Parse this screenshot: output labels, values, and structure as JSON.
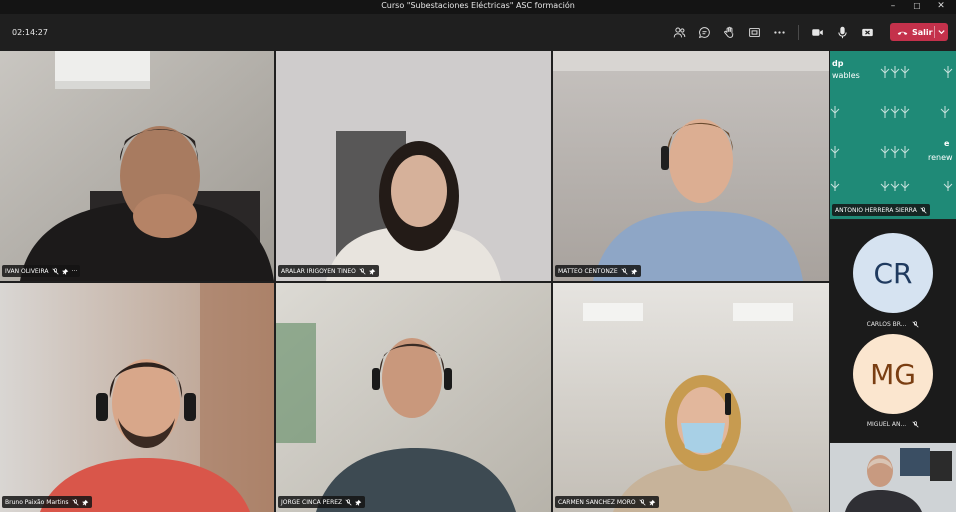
{
  "window": {
    "title": "Curso \"Subestaciones Eléctricas\" ASC formación",
    "minimize": "–",
    "maximize": "☐",
    "close": "✕"
  },
  "toolbar": {
    "timer": "02:14:27",
    "leave_label": "Salir"
  },
  "participants": [
    {
      "name": "IVAN OLIVEIRA",
      "more": "···"
    },
    {
      "name": "ARALAR IRIGOYEN TINEO"
    },
    {
      "name": "MATTEO CENTONZE"
    },
    {
      "name": "Bruno Paixão Martins"
    },
    {
      "name": "JORGE CINCA PEREZ"
    },
    {
      "name": "CARMEN SANCHEZ MORO"
    }
  ],
  "side_panel": {
    "presenter": {
      "name": "ANTONIO HERRERA SIERRA",
      "logo_texts": [
        "dp",
        "wables",
        "e",
        "renew"
      ]
    },
    "avatars": [
      {
        "initials": "CR",
        "name": "CARLOS BR...",
        "bg": "#d6e3f1",
        "fg": "#1f3a5f"
      },
      {
        "initials": "MG",
        "name": "MIGUEL AN...",
        "bg": "#fbe6cf",
        "fg": "#7a3e12"
      }
    ]
  },
  "colors": {
    "leave": "#c4314b",
    "toolbar": "#1f1f1f",
    "teal": "#1f8a77"
  }
}
